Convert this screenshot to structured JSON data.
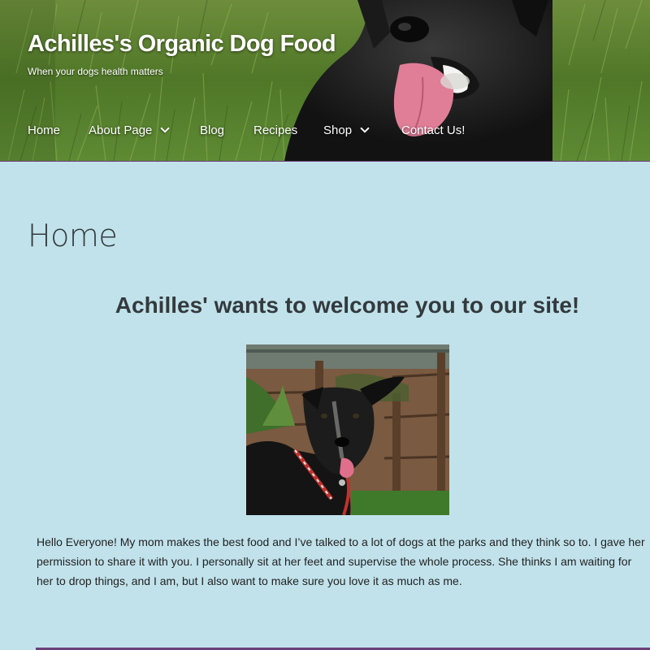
{
  "site": {
    "title": "Achilles's Organic Dog Food",
    "tagline": "When your dogs health matters"
  },
  "nav": {
    "items": [
      {
        "label": "Home",
        "has_dropdown": false
      },
      {
        "label": "About Page",
        "has_dropdown": true
      },
      {
        "label": "Blog",
        "has_dropdown": false
      },
      {
        "label": "Recipes",
        "has_dropdown": false
      },
      {
        "label": "Shop",
        "has_dropdown": true
      },
      {
        "label": "Contact Us!",
        "has_dropdown": false
      }
    ]
  },
  "page": {
    "title": "Home",
    "welcome_heading": "Achilles' wants to welcome you to our site!",
    "intro": "Hello Everyone! My mom makes the best food and I’ve talked to a lot of dogs at the parks and they think so to. I gave her permission to share it with you. I personally sit at her feet and supervise the whole process. She thinks I am waiting for her to drop things, and I am, but I also want to make sure you love it as much as me."
  },
  "colors": {
    "page_background": "#c1e2eb",
    "accent": "#6b3f7a",
    "text": "#333a3d",
    "header_text": "#ffffff"
  }
}
